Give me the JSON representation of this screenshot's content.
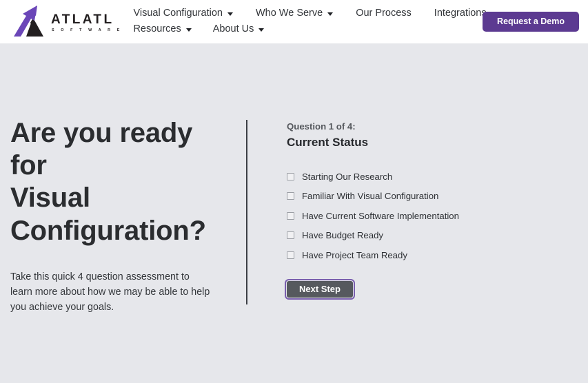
{
  "header": {
    "brand": {
      "name": "ATLATL",
      "sub": "S O F T W A R E",
      "logo_icon": "atlatl-arrow-logo",
      "colors": {
        "arrow": "#6b46b8",
        "mountain": "#231f20"
      }
    },
    "nav_items": [
      {
        "label": "Visual Configuration",
        "has_caret": true
      },
      {
        "label": "Who We Serve",
        "has_caret": true
      },
      {
        "label": "Our Process",
        "has_caret": false
      },
      {
        "label": "Integrations",
        "has_caret": true
      },
      {
        "label": "Resources",
        "has_caret": true
      },
      {
        "label": "About Us",
        "has_caret": true
      }
    ],
    "cta": {
      "label": "Request a Demo",
      "color": "#5c3a91"
    }
  },
  "hero": {
    "title_line1": "Are you ready for",
    "title_line2": "Visual Configuration?",
    "paragraph": "Take this quick 4 question assessment to learn more about how we may be able to help you achieve your goals."
  },
  "quiz": {
    "eyebrow": "Question 1 of 4:",
    "title": "Current Status",
    "options": [
      {
        "label": "Starting Our Research",
        "checked": false
      },
      {
        "label": "Familiar With Visual Configuration",
        "checked": false
      },
      {
        "label": "Have Current Software Implementation",
        "checked": false
      },
      {
        "label": "Have Budget Ready",
        "checked": false
      },
      {
        "label": "Have Project Team Ready",
        "checked": false
      }
    ],
    "next_label": "Next Step",
    "next_fill": "#56595e",
    "next_focus_ring": "#7a5fae"
  },
  "theme": {
    "page_background": "#e6e7eb",
    "header_background": "#ffffff",
    "accent_purple": "#5c3a91",
    "text_dark": "#2f3134"
  }
}
